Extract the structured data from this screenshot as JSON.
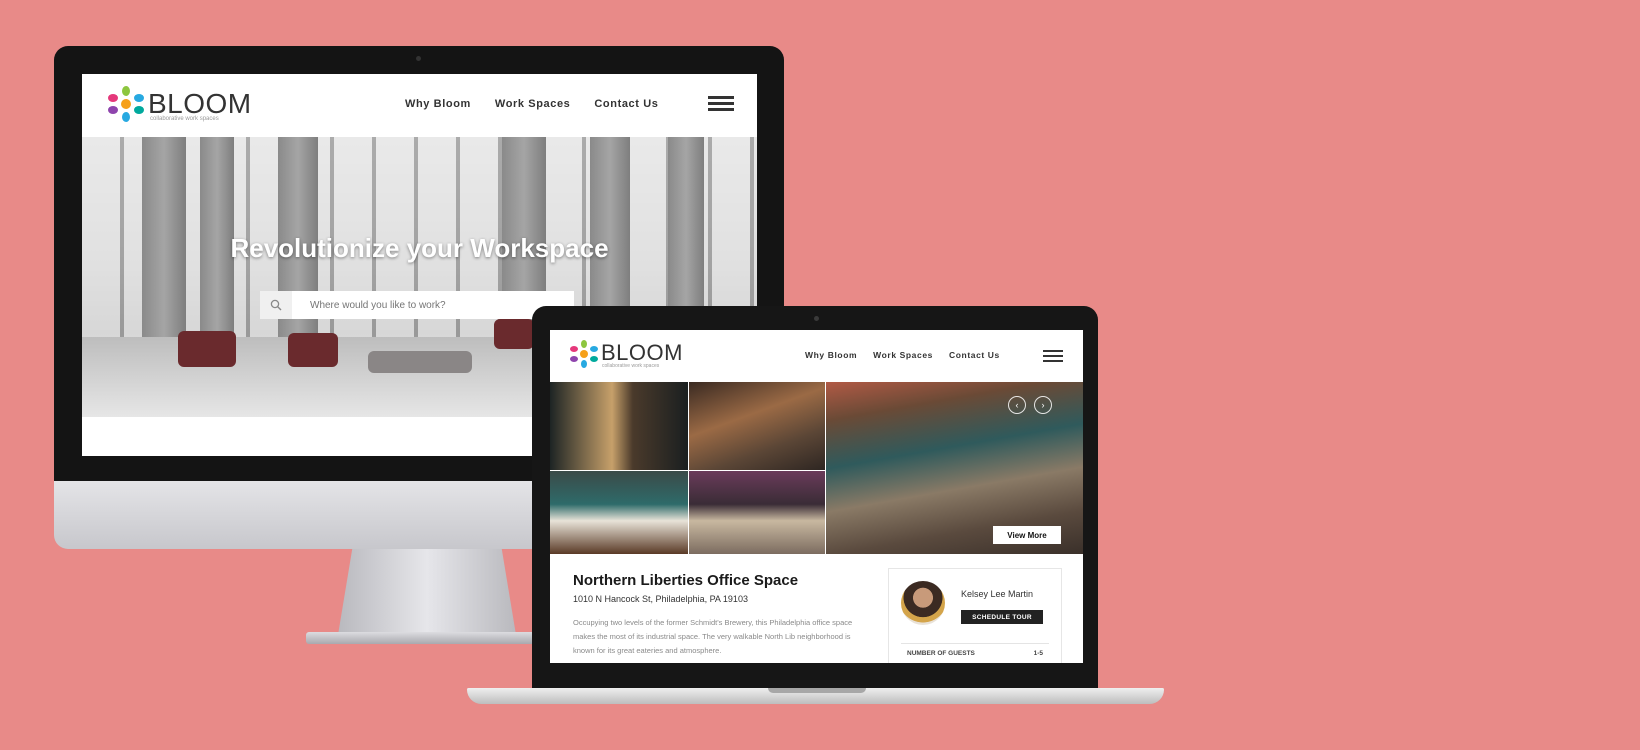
{
  "brand": {
    "name": "BLOOM",
    "tagline": "collaborative work spaces"
  },
  "nav": {
    "items": [
      {
        "label": "Why Bloom"
      },
      {
        "label": "Work Spaces"
      },
      {
        "label": "Contact Us"
      }
    ],
    "menu_icon": "hamburger-menu-icon"
  },
  "home": {
    "hero_title": "Revolutionize your Workspace",
    "search_placeholder": "Where would you like to work?",
    "search_icon": "search-icon"
  },
  "listing": {
    "view_more_label": "View More",
    "title": "Northern Liberties Office Space",
    "address": "1010 N Hancock St, Philadelphia, PA 19103",
    "description": "Occupying two levels of the former Schmidt's Brewery, this Philadelphia office space makes the most of its industrial space. The very walkable North Lib neighborhood is known for its great eateries and atmosphere.",
    "host_name": "Kelsey Lee Martin",
    "schedule_tour_label": "SCHEDULE TOUR",
    "guests_label": "NUMBER OF GUESTS",
    "guests_value": "1-5"
  },
  "colors": {
    "background": "#e88a88",
    "logo_petals": [
      "#e5387b",
      "#8dc63f",
      "#27a9e1",
      "#f6a01a",
      "#8e44ad",
      "#00a99d"
    ]
  }
}
